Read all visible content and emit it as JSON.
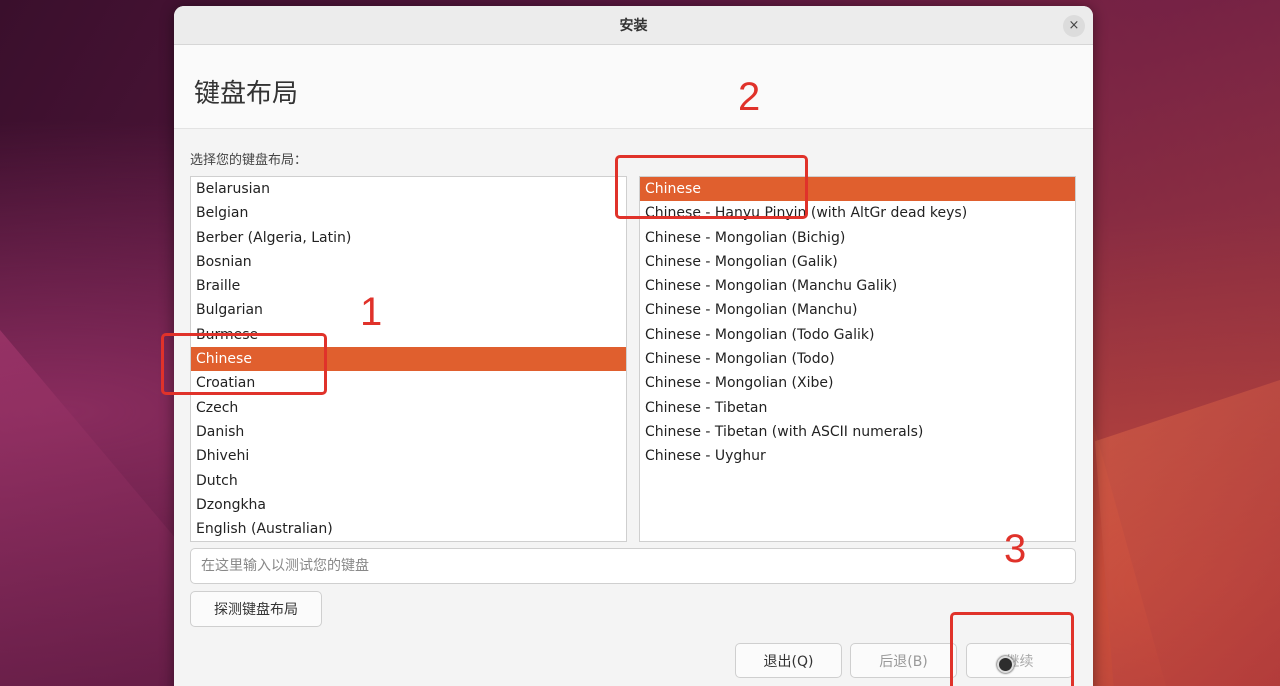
{
  "window": {
    "title": "安装",
    "close_icon": "×"
  },
  "page": {
    "title": "键盘布局",
    "prompt": "选择您的键盘布局："
  },
  "layouts": [
    "Belarusian",
    "Belgian",
    "Berber (Algeria, Latin)",
    "Bosnian",
    "Braille",
    "Bulgarian",
    "Burmese",
    "Chinese",
    "Croatian",
    "Czech",
    "Danish",
    "Dhivehi",
    "Dutch",
    "Dzongkha",
    "English (Australian)"
  ],
  "layouts_selected": "Chinese",
  "variants": [
    "Chinese",
    "Chinese - Hanyu Pinyin (with AltGr dead keys)",
    "Chinese - Mongolian (Bichig)",
    "Chinese - Mongolian (Galik)",
    "Chinese - Mongolian (Manchu Galik)",
    "Chinese - Mongolian (Manchu)",
    "Chinese - Mongolian (Todo Galik)",
    "Chinese - Mongolian (Todo)",
    "Chinese - Mongolian (Xibe)",
    "Chinese - Tibetan",
    "Chinese - Tibetan (with ASCII numerals)",
    "Chinese - Uyghur"
  ],
  "variants_selected": "Chinese",
  "test_input": {
    "placeholder": "在这里输入以测试您的键盘",
    "value": ""
  },
  "buttons": {
    "detect": "探测键盘布局",
    "quit": "退出(Q)",
    "back": "后退(B)",
    "continue": "继续"
  },
  "annotations": {
    "one": "1",
    "two": "2",
    "three": "3"
  },
  "colors": {
    "selection": "#e05f2e",
    "annotation": "#e0322a"
  }
}
